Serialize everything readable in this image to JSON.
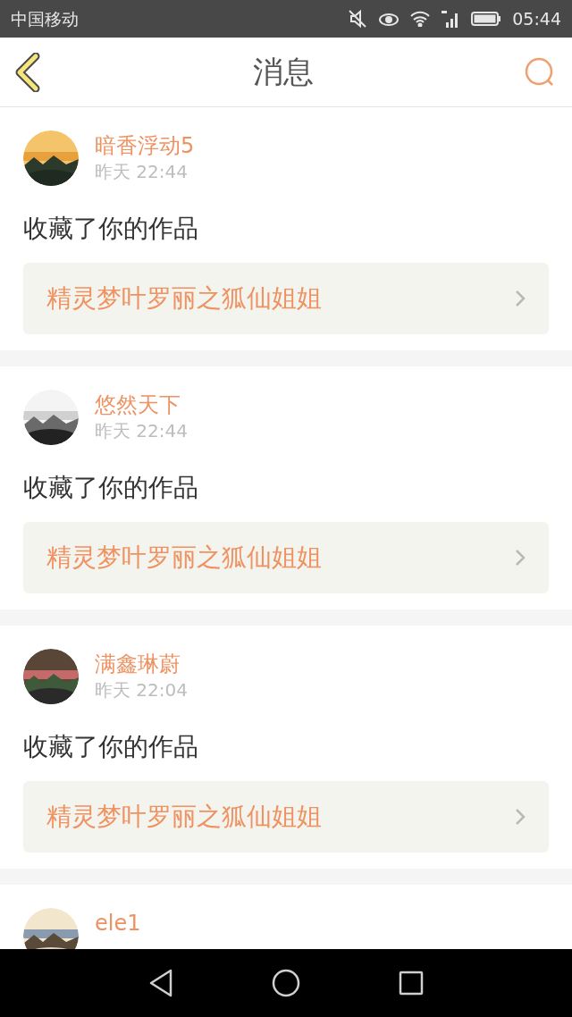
{
  "status_bar": {
    "carrier": "中国移动",
    "time": "05:44"
  },
  "header": {
    "title": "消息"
  },
  "messages": [
    {
      "name": "暗香浮动5",
      "time": "昨天 22:44",
      "action": "收藏了你的作品",
      "work": "精灵梦叶罗丽之狐仙姐姐"
    },
    {
      "name": "悠然天下",
      "time": "昨天 22:44",
      "action": "收藏了你的作品",
      "work": "精灵梦叶罗丽之狐仙姐姐"
    },
    {
      "name": "满鑫琳蔚",
      "time": "昨天 22:04",
      "action": "收藏了你的作品",
      "work": "精灵梦叶罗丽之狐仙姐姐"
    },
    {
      "name": "ele1"
    }
  ]
}
